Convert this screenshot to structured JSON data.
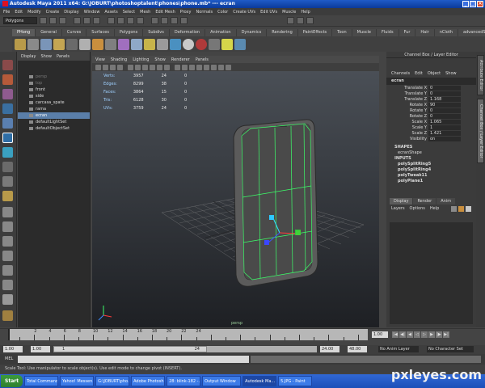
{
  "title": "Autodesk Maya 2011 x64: G:\\JOBURT\\photoshoptalent\\phones\\phone.mb* --- ecran",
  "menubar": [
    "File",
    "Edit",
    "Modify",
    "Create",
    "Display",
    "Window",
    "Assets",
    "Select",
    "Mesh",
    "Edit Mesh",
    "Proxy",
    "Normals",
    "Color",
    "Create UVs",
    "Edit UVs",
    "Muscle",
    "Help"
  ],
  "mode_select": "Polygons",
  "shelf_tabs": [
    "PHong",
    "General",
    "Curves",
    "Surfaces",
    "Polygons",
    "Subdivs",
    "Deformation",
    "Animation",
    "Dynamics",
    "Rendering",
    "PaintEffects",
    "Toon",
    "Muscle",
    "Fluids",
    "Fur",
    "Hair",
    "nCloth",
    "advancedSkeleton"
  ],
  "shelf_icons": [
    {
      "name": "cp-icon",
      "label": "CP",
      "color": "#c9a23a"
    },
    {
      "name": "hm-icon",
      "label": "Hm",
      "color": "#5aa0d0"
    },
    {
      "name": "f1-icon",
      "label": "F1",
      "color": "#d6d64a"
    },
    {
      "name": "sphere-icon",
      "label": "",
      "color": "#c7c7c7"
    }
  ],
  "outliner": {
    "menu": [
      "Display",
      "Show",
      "Panels"
    ],
    "items": [
      {
        "label": "persp",
        "state": "dim"
      },
      {
        "label": "top",
        "state": "dim"
      },
      {
        "label": "front",
        "state": "normal"
      },
      {
        "label": "side",
        "state": "normal"
      },
      {
        "label": "carcasa_spate",
        "state": "normal"
      },
      {
        "label": "rama",
        "state": "normal"
      },
      {
        "label": "ecran",
        "state": "selected"
      },
      {
        "label": "defaultLightSet",
        "state": "normal"
      },
      {
        "label": "defaultObjectSet",
        "state": "normal"
      }
    ]
  },
  "viewport": {
    "menu": [
      "View",
      "Shading",
      "Lighting",
      "Show",
      "Renderer",
      "Panels"
    ],
    "stats": [
      {
        "label": "Verts:",
        "v1": "3957",
        "v2": "24",
        "v3": "0"
      },
      {
        "label": "Edges:",
        "v1": "8299",
        "v2": "38",
        "v3": "0"
      },
      {
        "label": "Faces:",
        "v1": "3864",
        "v2": "15",
        "v3": "0"
      },
      {
        "label": "Tris:",
        "v1": "6128",
        "v2": "30",
        "v3": "0"
      },
      {
        "label": "UVs:",
        "v1": "3759",
        "v2": "24",
        "v3": "0"
      }
    ],
    "camera_label": "persp"
  },
  "channelbox": {
    "header": "Channel Box / Layer Editor",
    "menu": [
      "Channels",
      "Edit",
      "Object",
      "Show"
    ],
    "object": "ecran",
    "attributes": [
      {
        "name": "Translate X",
        "value": "0"
      },
      {
        "name": "Translate Y",
        "value": "0"
      },
      {
        "name": "Translate Z",
        "value": "1.168"
      },
      {
        "name": "Rotate X",
        "value": "90"
      },
      {
        "name": "Rotate Y",
        "value": "0"
      },
      {
        "name": "Rotate Z",
        "value": "0"
      },
      {
        "name": "Scale X",
        "value": "1.065"
      },
      {
        "name": "Scale Y",
        "value": "1"
      },
      {
        "name": "Scale Z",
        "value": "1.421"
      },
      {
        "name": "Visibility",
        "value": "on"
      }
    ],
    "shapes_label": "SHAPES",
    "shape": "ecranShape",
    "inputs_label": "INPUTS",
    "inputs": [
      "polySplitRing5",
      "polySplitRing4",
      "polyTweak11",
      "polyPlane1"
    ],
    "layer_tabs": [
      "Display",
      "Render",
      "Anim"
    ],
    "layer_menu": [
      "Layers",
      "Options",
      "Help"
    ],
    "side_tabs": [
      "Attribute Editor",
      "Channel Box / Layer Editor"
    ]
  },
  "timeline": {
    "ticks": [
      "2",
      "4",
      "6",
      "8",
      "10",
      "12",
      "14",
      "16",
      "18",
      "20",
      "22",
      "24"
    ],
    "current_frame": "1.00"
  },
  "range": {
    "start": "1.00",
    "inner_start": "1.00",
    "slider_value": "1",
    "slider_end": "24",
    "end": "24.00",
    "outer_end": "48.00",
    "anim_layer": "No Anim Layer",
    "character_set": "No Character Set"
  },
  "mel_label": "MEL",
  "help_line": "Scale Tool: Use manipulator to scale object(s). Use edit mode to change pivot (INSERT).",
  "taskbar": {
    "start": "Start",
    "tasks": [
      {
        "label": "Total Command...",
        "active": false
      },
      {
        "label": "Yahoo! Messen...",
        "active": false
      },
      {
        "label": "G:\\JOBURT\\pho...",
        "active": false
      },
      {
        "label": "Adobe Photosh...",
        "active": false
      },
      {
        "label": "28: blink-182 -...",
        "active": false
      },
      {
        "label": "Output Window",
        "active": false
      },
      {
        "label": "Autodesk Ma...",
        "active": true
      },
      {
        "label": "5.JPG - Paint",
        "active": false
      }
    ]
  },
  "watermark": "pxleyes.com"
}
